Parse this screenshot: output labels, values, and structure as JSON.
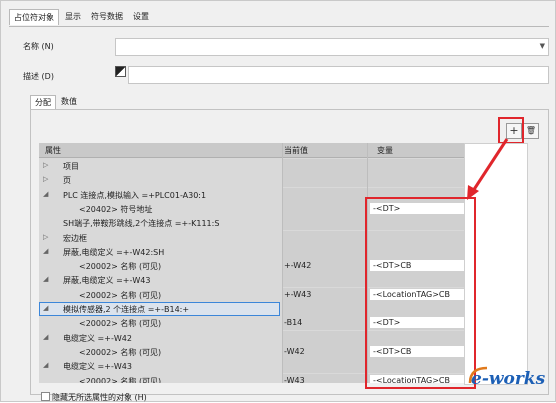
{
  "tabs": [
    "占位符对象",
    "显示",
    "符号数据",
    "设置"
  ],
  "fields": {
    "name_label": "名称 (N)",
    "desc_label": "描述 (D)"
  },
  "subtabs": [
    "分配",
    "数值"
  ],
  "toolbar": {
    "add": "+",
    "delete": "🗑"
  },
  "grid": {
    "headers": {
      "property": "属性",
      "current": "当前值",
      "variable": "变量"
    },
    "rows": [
      {
        "prop": "项目",
        "indent": 1,
        "toggle": "▷",
        "cur": "",
        "var": ""
      },
      {
        "prop": "页",
        "indent": 1,
        "toggle": "▷",
        "cur": "",
        "var": ""
      },
      {
        "prop": "PLC 连接点,模拟输入 =+PLC01-A30:1",
        "indent": 1,
        "toggle": "◢",
        "cur": "",
        "var": ""
      },
      {
        "prop": "<20402> 符号地址",
        "indent": 2,
        "toggle": "",
        "cur": "",
        "var": "-<DT>"
      },
      {
        "prop": "SH端子,带鞍形跳线,2个连接点 =+-K111:S",
        "indent": 0,
        "toggle": "",
        "cur": "",
        "var": ""
      },
      {
        "prop": "宏边框",
        "indent": 1,
        "toggle": "▷",
        "cur": "",
        "var": ""
      },
      {
        "prop": "屏蔽,电缆定义 =+-W42:SH",
        "indent": 1,
        "toggle": "◢",
        "cur": "",
        "var": ""
      },
      {
        "prop": "<20002> 名称 (可见)",
        "indent": 2,
        "toggle": "",
        "cur": "+-W42",
        "var": "-<DT>CB"
      },
      {
        "prop": "屏蔽,电缆定义 =+-W43",
        "indent": 1,
        "toggle": "◢",
        "cur": "",
        "var": ""
      },
      {
        "prop": "<20002> 名称 (可见)",
        "indent": 2,
        "toggle": "",
        "cur": "+-W43",
        "var": "-<LocationTAG>CB"
      },
      {
        "prop": "模拟传感器,2 个连接点 =+-B14:+",
        "indent": 1,
        "toggle": "◢",
        "cur": "",
        "var": ""
      },
      {
        "prop": "<20002> 名称 (可见)",
        "indent": 2,
        "toggle": "",
        "cur": "-B14",
        "var": "-<DT>"
      },
      {
        "prop": "电缆定义 =+-W42",
        "indent": 1,
        "toggle": "◢",
        "cur": "",
        "var": ""
      },
      {
        "prop": "<20002> 名称 (可见)",
        "indent": 2,
        "toggle": "",
        "cur": "-W42",
        "var": "-<DT>CB"
      },
      {
        "prop": "电缆定义 =+-W43",
        "indent": 1,
        "toggle": "◢",
        "cur": "",
        "var": ""
      },
      {
        "prop": "<20002> 名称 (可见)",
        "indent": 2,
        "toggle": "",
        "cur": "-W43",
        "var": "-<LocationTAG>CB"
      }
    ]
  },
  "checkbox_label": "隐藏无所选属性的对象 (H)",
  "watermark": "e-works"
}
